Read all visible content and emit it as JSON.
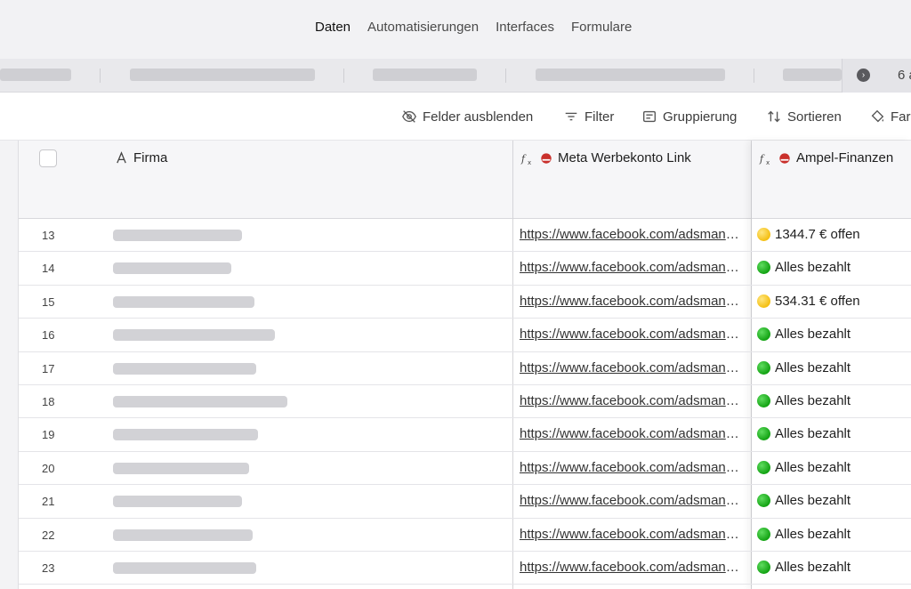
{
  "topnav": {
    "tabs": [
      {
        "label": "Daten",
        "active": true
      },
      {
        "label": "Automatisierungen",
        "active": false
      },
      {
        "label": "Interfaces",
        "active": false
      },
      {
        "label": "Formulare",
        "active": false
      }
    ]
  },
  "viewbar": {
    "count_label": "6 a"
  },
  "toolbar": {
    "hide_fields": "Felder ausblenden",
    "filter": "Filter",
    "group": "Gruppierung",
    "sort": "Sortieren",
    "color": "Farb"
  },
  "columns": {
    "firma": "Firma",
    "meta_link": "Meta Werbekonto Link",
    "ampel": "Ampel-Finanzen"
  },
  "rows": [
    {
      "num": "13",
      "link": "https://www.facebook.com/adsmanager",
      "status": "1344.7 € offen",
      "status_color": "yellow",
      "firma_bar": 0.74
    },
    {
      "num": "14",
      "link": "https://www.facebook.com/adsmanager",
      "status": "Alles bezahlt",
      "status_color": "green",
      "firma_bar": 0.68
    },
    {
      "num": "15",
      "link": "https://www.facebook.com/adsmanager",
      "status": "534.31 € offen",
      "status_color": "yellow",
      "firma_bar": 0.81
    },
    {
      "num": "16",
      "link": "https://www.facebook.com/adsmanager",
      "status": "Alles bezahlt",
      "status_color": "green",
      "firma_bar": 0.93
    },
    {
      "num": "17",
      "link": "https://www.facebook.com/adsmanager",
      "status": "Alles bezahlt",
      "status_color": "green",
      "firma_bar": 0.82
    },
    {
      "num": "18",
      "link": "https://www.facebook.com/adsmanager",
      "status": "Alles bezahlt",
      "status_color": "green",
      "firma_bar": 1.0
    },
    {
      "num": "19",
      "link": "https://www.facebook.com/adsmanager",
      "status": "Alles bezahlt",
      "status_color": "green",
      "firma_bar": 0.83
    },
    {
      "num": "20",
      "link": "https://www.facebook.com/adsmanager",
      "status": "Alles bezahlt",
      "status_color": "green",
      "firma_bar": 0.78
    },
    {
      "num": "21",
      "link": "https://www.facebook.com/adsmanager",
      "status": "Alles bezahlt",
      "status_color": "green",
      "firma_bar": 0.74
    },
    {
      "num": "22",
      "link": "https://www.facebook.com/adsmanager",
      "status": "Alles bezahlt",
      "status_color": "green",
      "firma_bar": 0.8
    },
    {
      "num": "23",
      "link": "https://www.facebook.com/adsmanager",
      "status": "Alles bezahlt",
      "status_color": "green",
      "firma_bar": 0.82
    }
  ]
}
